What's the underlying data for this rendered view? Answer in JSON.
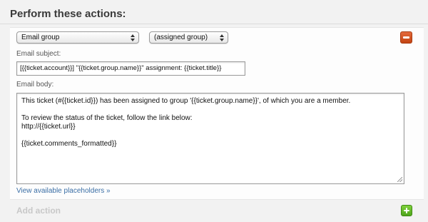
{
  "section": {
    "title": "Perform these actions:"
  },
  "action": {
    "type_select": "Email group",
    "group_select": "(assigned group)",
    "subject_label": "Email subject:",
    "subject_value": "[{{ticket.account}}] \"{{ticket.group.name}}\" assignment:  {{ticket.title}}",
    "body_label": "Email body:",
    "body_lines": [
      "This ticket (#{{ticket.id}}) has been assigned to group '{{ticket.group.name}}', of which you are a member.",
      "",
      "To review the status of the ticket, follow the link below:",
      "http://{{ticket.url}}",
      "",
      "{{ticket.comments_formatted}}"
    ],
    "placeholders_link": "View available placeholders »",
    "remove_icon": "minus-icon"
  },
  "add": {
    "label": "Add action",
    "icon": "plus-icon"
  },
  "colors": {
    "remove": "#d4531f",
    "add": "#62b828",
    "link": "#3a6ea5"
  }
}
